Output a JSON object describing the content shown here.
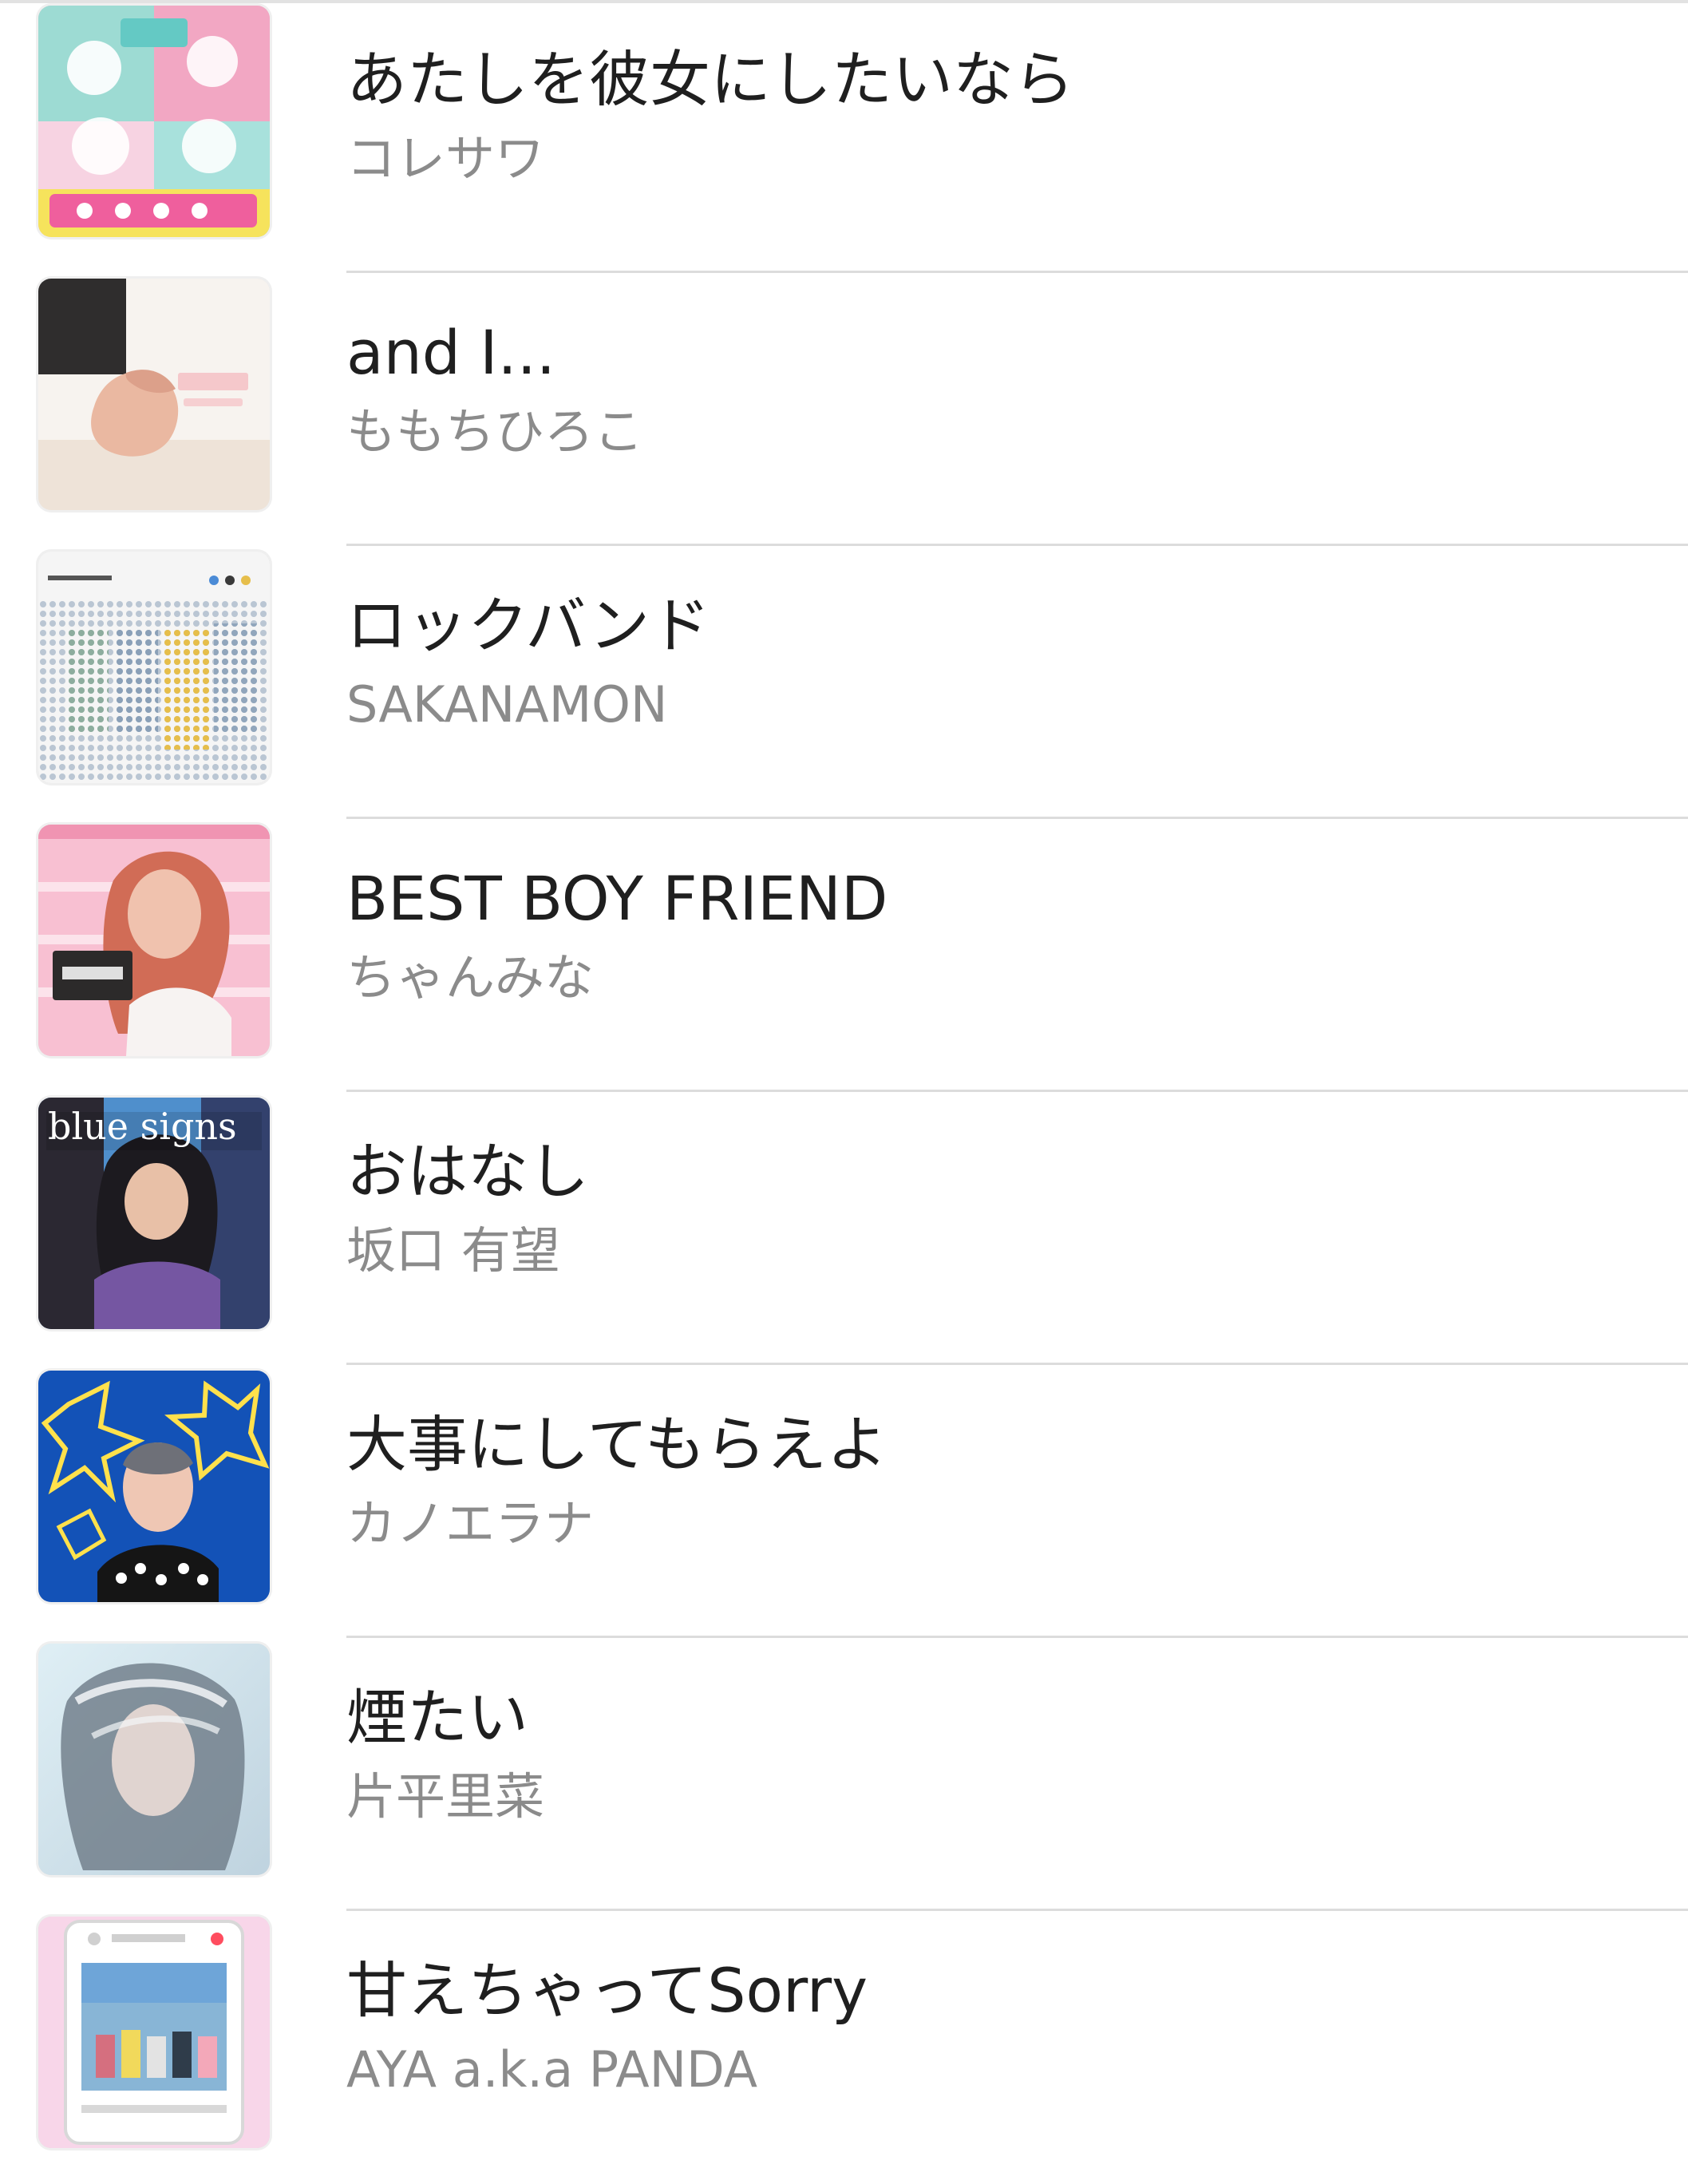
{
  "song_list": {
    "items": [
      {
        "title": "あたしを彼女にしたいなら",
        "artist": "コレサワ",
        "art_icon": "album-art-pastel-illustration"
      },
      {
        "title": "and I...",
        "artist": "ももちひろこ",
        "art_icon": "album-art-hands-beach"
      },
      {
        "title": "ロックバンド",
        "artist": "SAKANAMON",
        "art_icon": "album-art-dotted-band"
      },
      {
        "title": "BEST BOY FRIEND",
        "artist": "ちゃんみな",
        "art_icon": "album-art-pink-portrait"
      },
      {
        "title": "おはなし",
        "artist": "坂口 有望",
        "art_icon": "album-art-blue-signs"
      },
      {
        "title": "大事にしてもらえよ",
        "artist": "カノエラナ",
        "art_icon": "album-art-blue-yellow-stars"
      },
      {
        "title": "煙たい",
        "artist": "片平里菜",
        "art_icon": "album-art-soft-portrait"
      },
      {
        "title": "甘えちゃってSorry",
        "artist": "AYA a.k.a PANDA",
        "art_icon": "album-art-phone-photo"
      }
    ]
  },
  "colors": {
    "title_text": "#1f1f1f",
    "artist_text": "#8b8b8b",
    "divider": "#dcdcdc",
    "background": "#ffffff"
  }
}
